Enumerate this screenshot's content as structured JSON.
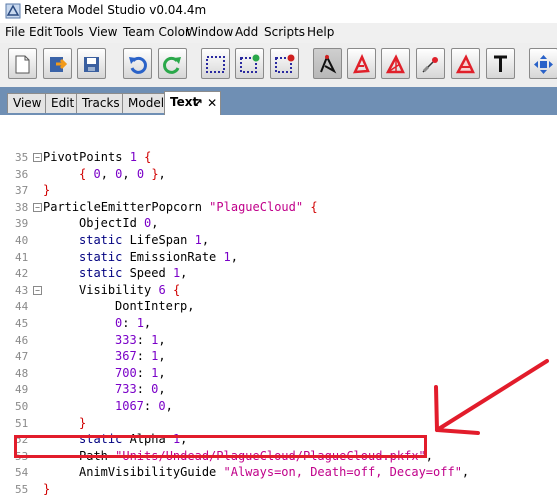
{
  "window": {
    "title": "Retera Model Studio v0.04.4m"
  },
  "menu": [
    "File",
    "Edit",
    "Tools",
    "View",
    "Team Color",
    "Window",
    "Add",
    "Scripts",
    "Help"
  ],
  "toolbar": {
    "buttons": [
      "new-file-icon",
      "open-file-icon",
      "save-icon",
      "undo-icon",
      "redo-icon",
      "select-icon",
      "add-select-icon",
      "deselect-icon",
      "move-vertex-icon",
      "rotate-vertex-icon",
      "scale-vertex-icon",
      "extrude-icon",
      "snap-icon",
      "text-icon",
      "move-view-icon"
    ]
  },
  "tabs": [
    "View",
    "Edit",
    "Tracks",
    "Model",
    "Text"
  ],
  "active_tab": "Text",
  "code": {
    "lines": [
      {
        "n": "35",
        "text": "PivotPoints 1 {"
      },
      {
        "n": "36",
        "text": "{ 0, 0, 0 },"
      },
      {
        "n": "37",
        "text": "}"
      },
      {
        "n": "38",
        "text": "ParticleEmitterPopcorn \"PlagueCloud\" {"
      },
      {
        "n": "39",
        "text": "ObjectId 0,"
      },
      {
        "n": "40",
        "text": "static LifeSpan 1,"
      },
      {
        "n": "41",
        "text": "static EmissionRate 1,"
      },
      {
        "n": "42",
        "text": "static Speed 1,"
      },
      {
        "n": "43",
        "text": "Visibility 6 {"
      },
      {
        "n": "44",
        "text": "DontInterp,"
      },
      {
        "n": "45",
        "text": "0: 1,"
      },
      {
        "n": "46",
        "text": "333: 1,"
      },
      {
        "n": "47",
        "text": "367: 1,"
      },
      {
        "n": "48",
        "text": "700: 1,"
      },
      {
        "n": "49",
        "text": "733: 0,"
      },
      {
        "n": "50",
        "text": "1067: 0,"
      },
      {
        "n": "51",
        "text": "}"
      },
      {
        "n": "52",
        "text": "static Alpha 1,"
      },
      {
        "n": "53",
        "text": "Path \"Units/Undead/PlagueCloud/PlagueCloud.pkfx\","
      },
      {
        "n": "54",
        "text": "AnimVisibilityGuide \"Always=on, Death=off, Decay=off\","
      },
      {
        "n": "55",
        "text": "}"
      }
    ]
  },
  "colors": {
    "tab_strip": "#6f8fb4",
    "annotation": "#e21c2b",
    "keyword": "#000080",
    "number": "#7a00c8",
    "string": "#c0008a"
  }
}
